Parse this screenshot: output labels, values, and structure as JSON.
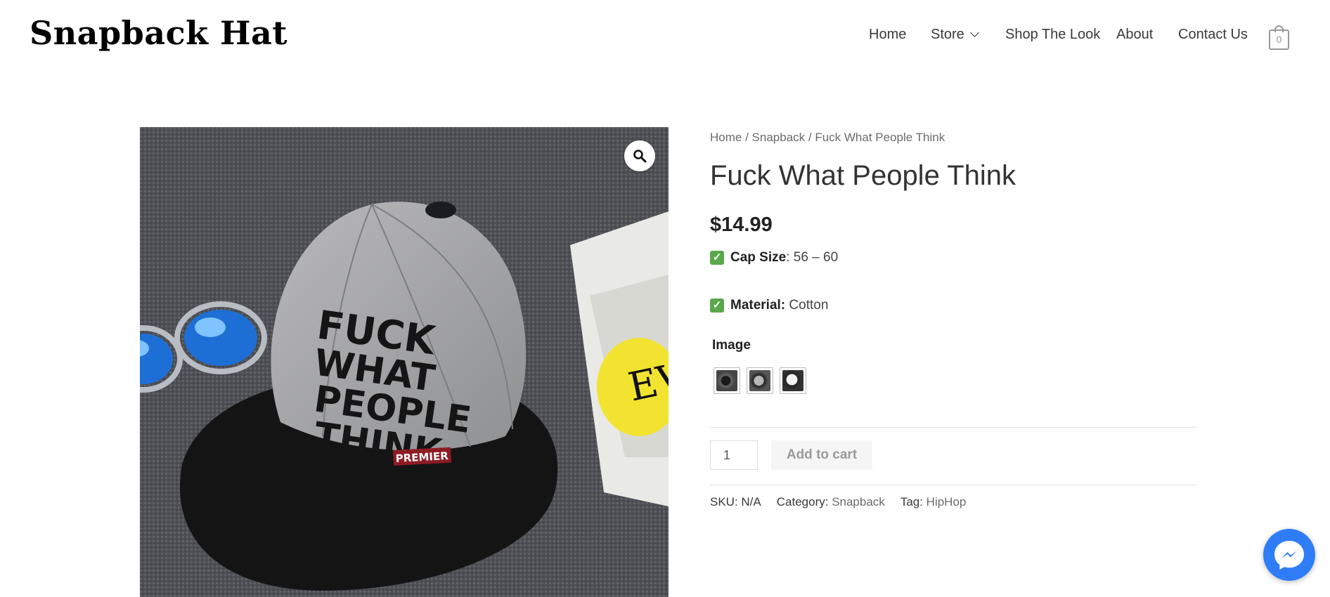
{
  "site": {
    "logo": "Snapback Hat"
  },
  "nav": {
    "items": [
      {
        "label": "Home"
      },
      {
        "label": "Store"
      },
      {
        "label": "Shop The Look"
      },
      {
        "label": "About"
      },
      {
        "label": "Contact Us"
      }
    ],
    "cart_count": "0"
  },
  "breadcrumb": {
    "home": "Home",
    "sep1": " / ",
    "category": "Snapback",
    "sep2": " / ",
    "current": "Fuck What People Think"
  },
  "product": {
    "title": "Fuck What People Think",
    "price": "$14.99",
    "features": [
      {
        "label": "Cap Size",
        "suffix": ": ",
        "value": "56 – 60"
      },
      {
        "label": "Material:",
        "suffix": " ",
        "value": "Cotton"
      }
    ],
    "variation_label": "Image",
    "quantity": "1",
    "add_to_cart": "Add to cart",
    "meta": {
      "sku_label": "SKU: ",
      "sku_value": "N/A",
      "category_label": "Category: ",
      "category_value": "Snapback",
      "tag_label": "Tag: ",
      "tag_value": "HipHop"
    },
    "image_print_text": "PREMIER"
  },
  "colors": {
    "accent": "#2f7df6",
    "check": "#5aa84a",
    "cap_crown": "#a9a9ab",
    "cap_brim": "#141414"
  }
}
